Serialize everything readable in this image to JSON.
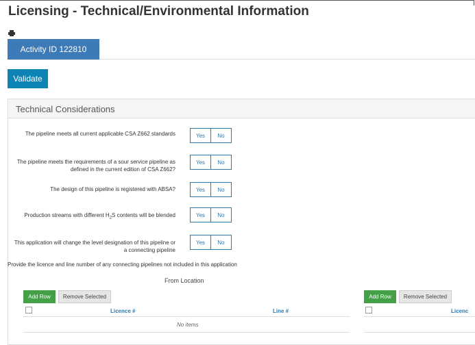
{
  "page": {
    "title": "Licensing - Technical/Environmental Information"
  },
  "icons": {
    "print": "print-icon"
  },
  "tabs": [
    {
      "label": "Activity ID 122810"
    }
  ],
  "actions": {
    "validate_label": "Validate"
  },
  "panel": {
    "title": "Technical Considerations",
    "questions": [
      {
        "label": "The pipeline meets all current applicable CSA Z662 standards",
        "yes": "Yes",
        "no": "No"
      },
      {
        "label": "The pipeline meets the requirements of a sour service pipeline as defined in the current edition of CSA Z662?",
        "yes": "Yes",
        "no": "No"
      },
      {
        "label": "The design of this pipeline is registered with ABSA?",
        "yes": "Yes",
        "no": "No"
      },
      {
        "label_pre": "Production streams with different H",
        "label_sub": "2",
        "label_post": "S contents will be blended",
        "yes": "Yes",
        "no": "No"
      },
      {
        "label": "This application will change the level designation of this pipeline or a connecting pipeline",
        "yes": "Yes",
        "no": "No"
      }
    ],
    "connecting_note": "Provide the licence and line number of any connecting pipelines not included in this application",
    "from_location": {
      "heading": "From Location",
      "add_row": "Add Row",
      "remove_selected": "Remove Selected",
      "columns": [
        "Licence #",
        "Line #"
      ],
      "empty_text": "No items"
    },
    "to_location": {
      "add_row": "Add Row",
      "remove_selected": "Remove Selected",
      "columns": [
        "Licenc"
      ]
    }
  }
}
